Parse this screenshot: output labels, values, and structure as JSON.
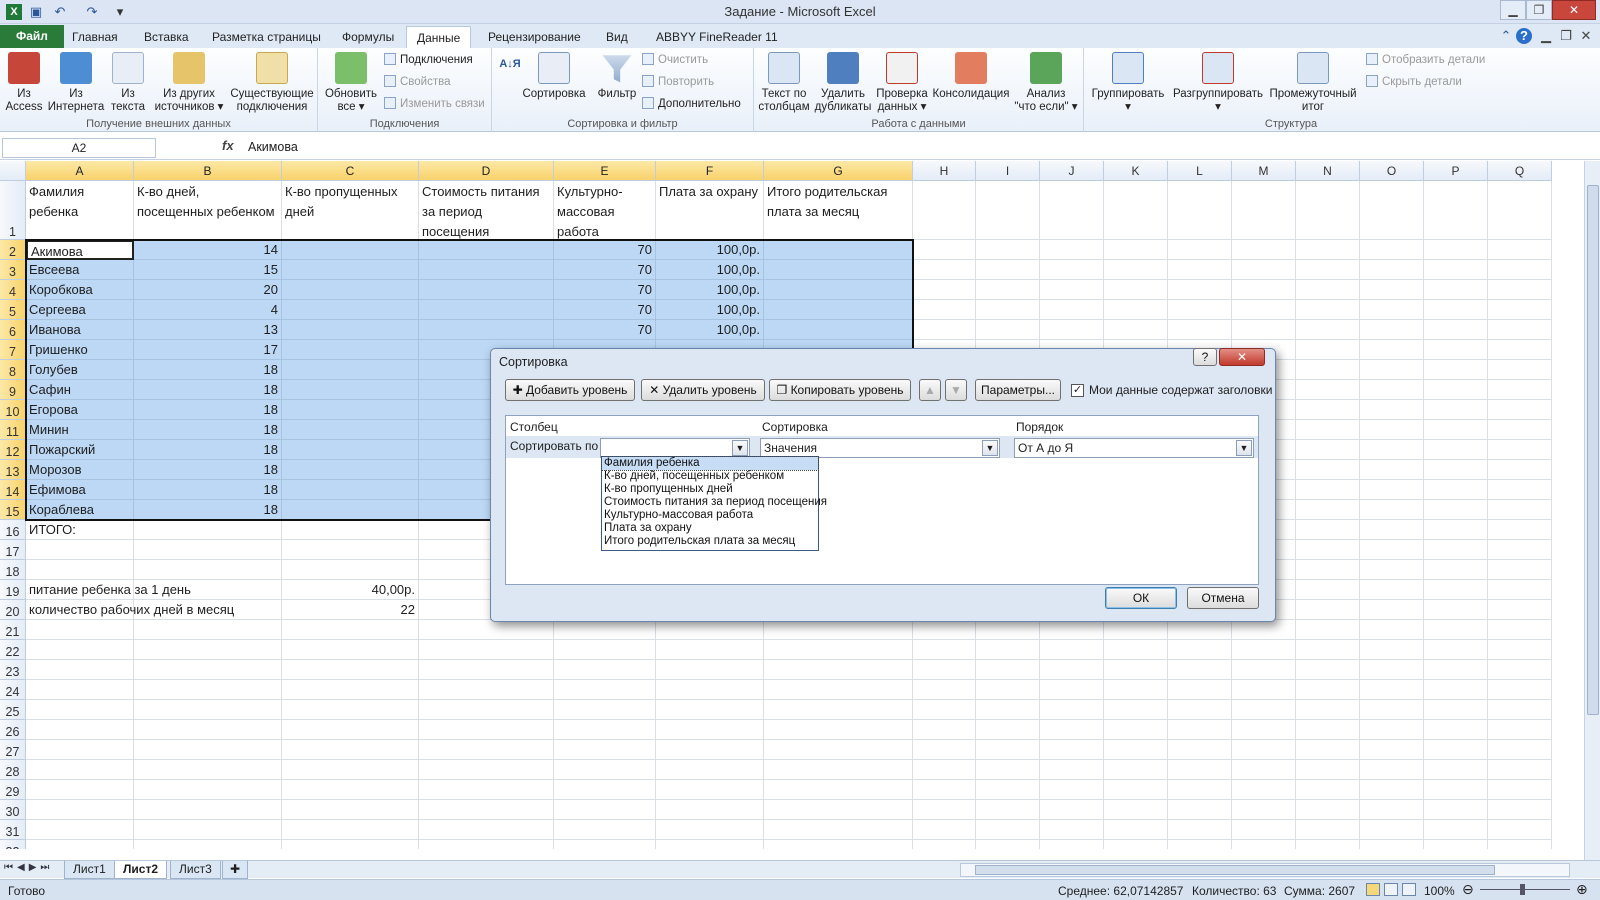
{
  "window": {
    "title": "Задание  -  Microsoft Excel",
    "min": "▁",
    "max": "❐",
    "close": "✕"
  },
  "tabs": [
    "Файл",
    "Главная",
    "Вставка",
    "Разметка страницы",
    "Формулы",
    "Данные",
    "Рецензирование",
    "Вид",
    "ABBYY FineReader 11"
  ],
  "ribbon": {
    "get_external": {
      "label": "Получение внешних данных",
      "access": "Из\nAccess",
      "web": "Из\nИнтернета",
      "text": "Из\nтекста",
      "other": "Из других\nисточников ▾",
      "existing": "Существующие\nподключения"
    },
    "connections": {
      "label": "Подключения",
      "refresh": "Обновить\nвсе ▾",
      "conn": "Подключения",
      "props": "Свойства",
      "links": "Изменить связи"
    },
    "sort_filter": {
      "label": "Сортировка и фильтр",
      "az": "А↓Я",
      "sort": "Сортировка",
      "filter": "Фильтр",
      "clear": "Очистить",
      "reapply": "Повторить",
      "advanced": "Дополнительно"
    },
    "data_tools": {
      "label": "Работа с данными",
      "t2c": "Текст по\nстолбцам",
      "dups": "Удалить\nдубликаты",
      "validate": "Проверка\nданных ▾",
      "consolidate": "Консолидация",
      "whatif": "Анализ\n\"что если\" ▾"
    },
    "outline": {
      "label": "Структура",
      "group": "Группировать\n▾",
      "ungroup": "Разгруппировать\n▾",
      "subtotal": "Промежуточный\nитог",
      "show": "Отобразить детали",
      "hide": "Скрыть детали"
    }
  },
  "formula_bar": {
    "name_box": "A2",
    "fx": "fx",
    "content": "Акимова"
  },
  "columns": [
    "A",
    "B",
    "C",
    "D",
    "E",
    "F",
    "G",
    "H",
    "I",
    "J",
    "K",
    "L",
    "M",
    "N",
    "O",
    "P",
    "Q"
  ],
  "rows": [
    "1",
    "2",
    "3",
    "4",
    "5",
    "6",
    "7",
    "8",
    "9",
    "10",
    "11",
    "12",
    "13",
    "14",
    "15",
    "16",
    "17",
    "18",
    "19",
    "20",
    "21",
    "22",
    "23",
    "24",
    "25",
    "26",
    "27",
    "28",
    "29",
    "30",
    "31",
    "32"
  ],
  "headers": [
    "Фамилия ребенка",
    "К-во дней, посещенных ребенком",
    "К-во пропущенных дней",
    "Стоимость питания за период посещения",
    "Культурно-массовая работа",
    "Плата за охрану",
    "Итого родительская плата за месяц"
  ],
  "table": [
    {
      "name": "Акимова",
      "days": "14",
      "cult": "70",
      "guard": "100,0р."
    },
    {
      "name": "Евсеева",
      "days": "15",
      "cult": "70",
      "guard": "100,0р."
    },
    {
      "name": "Коробкова",
      "days": "20",
      "cult": "70",
      "guard": "100,0р."
    },
    {
      "name": "Сергеева",
      "days": "4",
      "cult": "70",
      "guard": "100,0р."
    },
    {
      "name": "Иванова",
      "days": "13",
      "cult": "70",
      "guard": "100,0р."
    },
    {
      "name": "Гришенко",
      "days": "17",
      "cult": "",
      "guard": ""
    },
    {
      "name": "Голубев",
      "days": "18",
      "cult": "",
      "guard": ""
    },
    {
      "name": "Сафин",
      "days": "18",
      "cult": "",
      "guard": ""
    },
    {
      "name": "Егорова",
      "days": "18",
      "cult": "",
      "guard": ""
    },
    {
      "name": "Минин",
      "days": "18",
      "cult": "",
      "guard": ""
    },
    {
      "name": "Пожарский",
      "days": "18",
      "cult": "",
      "guard": ""
    },
    {
      "name": "Морозов",
      "days": "18",
      "cult": "",
      "guard": ""
    },
    {
      "name": "Ефимова",
      "days": "18",
      "cult": "",
      "guard": ""
    },
    {
      "name": "Кораблева",
      "days": "18",
      "cult": "",
      "guard": ""
    }
  ],
  "total_label": "ИТОГО:",
  "params": [
    {
      "label": "питание ребенка за 1 день",
      "value": "40,00р."
    },
    {
      "label": "количество рабочих дней в месяц",
      "value": "22"
    }
  ],
  "sheets": [
    "Лист1",
    "Лист2",
    "Лист3"
  ],
  "status": {
    "ready": "Готово",
    "avg": "Среднее: 62,07142857",
    "count": "Количество: 63",
    "sum": "Сумма: 2607",
    "zoom": "100%"
  },
  "dialog": {
    "title": "Сортировка",
    "help": "?",
    "close": "✕",
    "add_level": "Добавить уровень",
    "delete_level": "Удалить уровень",
    "copy_level": "Копировать уровень",
    "options": "Параметры...",
    "has_headers": "Мои данные содержат заголовки",
    "col_column": "Столбец",
    "col_sort": "Сортировка",
    "col_order": "Порядок",
    "sort_by": "Сортировать по",
    "sort_on": "Значения",
    "order": "От А до Я",
    "ok": "ОК",
    "cancel": "Отмена",
    "dropdown": [
      "Фамилия ребенка",
      "К-во дней, посещенных ребенком",
      "К-во пропущенных дней",
      "Стоимость питания за период посещения",
      "Культурно-массовая работа",
      "Плата за охрану",
      "Итого родительская плата за месяц"
    ]
  }
}
